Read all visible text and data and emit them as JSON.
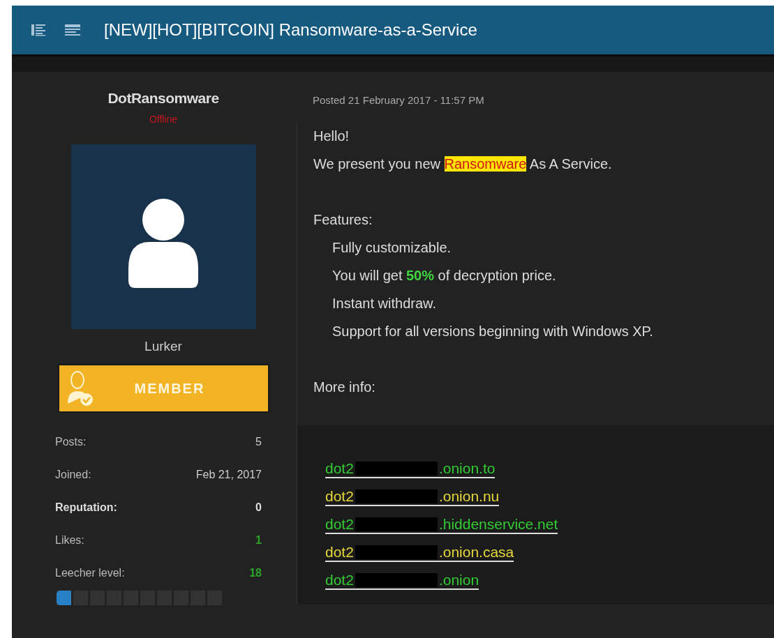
{
  "topic": {
    "title": "[NEW][HOT][BITCOIN] Ransomware-as-a-Service"
  },
  "author": {
    "name": "DotRansomware",
    "status": "Offline",
    "rank": "Lurker",
    "badge": "MEMBER",
    "stats": [
      {
        "label": "Posts:",
        "value": "5",
        "kind": "plain"
      },
      {
        "label": "Joined:",
        "value": "Feb 21, 2017",
        "kind": "plain"
      },
      {
        "label": "Reputation:",
        "value": "0",
        "kind": "bold"
      },
      {
        "label": "Likes:",
        "value": "1",
        "kind": "green"
      },
      {
        "label": "Leecher level:",
        "value": "18",
        "kind": "green"
      }
    ],
    "level": 0.1
  },
  "post": {
    "posted": "Posted 21 February 2017 - 11:57 PM",
    "lines": [
      {
        "kind": "text",
        "parts": [
          {
            "text": "Hello!",
            "kind": "plain"
          }
        ]
      },
      {
        "kind": "text",
        "parts": [
          {
            "text": "We present you new ",
            "kind": "plain"
          },
          {
            "text": "Ransomware",
            "kind": "highlight"
          },
          {
            "text": " As A Service.",
            "kind": "plain"
          }
        ]
      },
      {
        "kind": "blank"
      },
      {
        "kind": "text",
        "parts": [
          {
            "text": "Features:",
            "kind": "plain"
          }
        ]
      },
      {
        "kind": "item",
        "parts": [
          {
            "text": "Fully customizable.",
            "kind": "plain"
          }
        ]
      },
      {
        "kind": "item",
        "parts": [
          {
            "text": "You will get ",
            "kind": "plain"
          },
          {
            "text": "50%",
            "kind": "green"
          },
          {
            "text": " of decryption price.",
            "kind": "plain"
          }
        ]
      },
      {
        "kind": "item",
        "parts": [
          {
            "text": "Instant withdraw.",
            "kind": "plain"
          }
        ]
      },
      {
        "kind": "item",
        "parts": [
          {
            "text": "Support for all versions beginning with Windows XP.",
            "kind": "plain"
          }
        ]
      },
      {
        "kind": "blank"
      },
      {
        "kind": "text",
        "parts": [
          {
            "text": "More info:",
            "kind": "plain"
          }
        ]
      }
    ],
    "links": [
      {
        "prefix": "dot2",
        "suffix": ".onion.to",
        "color": "#33cc33"
      },
      {
        "prefix": "dot2",
        "suffix": ".onion.nu",
        "color": "#e6d83a"
      },
      {
        "prefix": "dot2",
        "suffix": ".hiddenservice.net",
        "color": "#33cc33"
      },
      {
        "prefix": "dot2",
        "suffix": ".onion.casa",
        "color": "#e6d83a"
      },
      {
        "prefix": "dot2",
        "suffix": ".onion",
        "color": "#33cc33"
      }
    ]
  }
}
